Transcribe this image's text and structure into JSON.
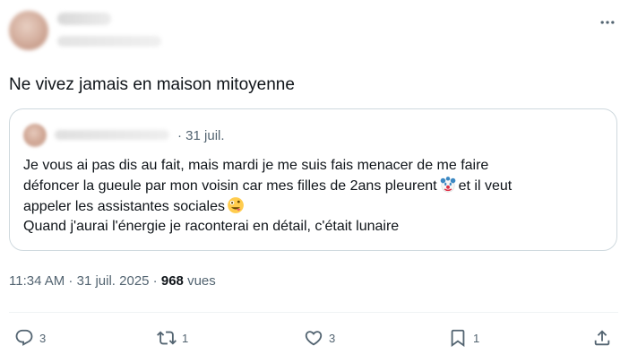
{
  "author": {
    "name": "",
    "handle": ""
  },
  "tweet": {
    "text": "Ne vivez jamais en maison mitoyenne"
  },
  "quote": {
    "author": "",
    "date": "· 31 juil.",
    "line1": "Je vous ai pas dis au fait, mais mardi je me suis fais menacer de me faire",
    "line2_a": "défoncer la gueule par mon voisin car mes filles de 2ans pleurent",
    "line2_b": "et il veut",
    "line3": "appeler les assistantes sociales",
    "line4": "Quand j'aurai l'énergie je raconterai en détail, c'était lunaire",
    "emoji_1": "clown-face-emoji",
    "emoji_2": "zany-face-emoji"
  },
  "meta": {
    "time": "11:34 AM",
    "separator1": " · ",
    "date": "31 juil. 2025",
    "separator2": " · ",
    "views_count": "968",
    "views_label": "vues"
  },
  "actions": {
    "reply_count": "3",
    "retweet_count": "1",
    "like_count": "3",
    "bookmark_count": "1"
  },
  "icons": {
    "more": "more-horizontal-icon",
    "reply": "reply-icon",
    "retweet": "retweet-icon",
    "like": "heart-icon",
    "bookmark": "bookmark-icon",
    "share": "share-icon"
  },
  "colors": {
    "text_primary": "#0f1419",
    "text_secondary": "#536471",
    "border": "#cfd9de"
  }
}
